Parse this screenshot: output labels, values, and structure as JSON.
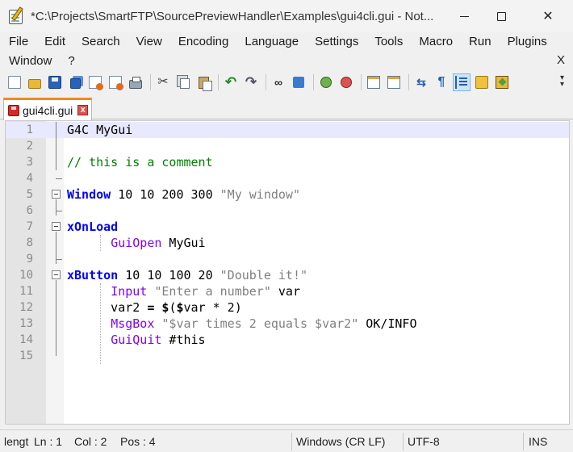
{
  "window": {
    "title": "*C:\\Projects\\SmartFTP\\SourcePreviewHandler\\Examples\\gui4cli.gui - Not..."
  },
  "menu": {
    "row1": [
      "File",
      "Edit",
      "Search",
      "View",
      "Encoding",
      "Language",
      "Settings",
      "Tools",
      "Macro",
      "Run",
      "Plugins"
    ],
    "row2": [
      "Window",
      "?"
    ],
    "close_doc": "X"
  },
  "toolbar": {
    "buttons": [
      "new-file-icon",
      "open-folder-icon",
      "save-icon",
      "save-all-icon",
      "close-icon",
      "close-all-icon",
      "print-icon",
      "cut-icon",
      "copy-icon",
      "paste-icon",
      "undo-icon",
      "redo-icon",
      "find-icon",
      "replace-icon",
      "zoom-in-icon",
      "zoom-out-icon",
      "sync-vertical-icon",
      "sync-horizontal-icon",
      "word-wrap-icon",
      "show-all-characters-icon",
      "indent-guide-icon",
      "user-language-icon",
      "bookmark-icon"
    ]
  },
  "tab": {
    "label": "gui4cli.gui",
    "close": "x"
  },
  "editor": {
    "lines": [
      {
        "n": "1",
        "tokens": [
          {
            "t": "G4C MyGui",
            "c": "plain"
          }
        ]
      },
      {
        "n": "2",
        "tokens": []
      },
      {
        "n": "3",
        "tokens": [
          {
            "t": "// this is a comment",
            "c": "cmt"
          }
        ]
      },
      {
        "n": "4",
        "tokens": []
      },
      {
        "n": "5",
        "tokens": [
          {
            "t": "Window",
            "c": "kw"
          },
          {
            "t": " 10 10 200 300 ",
            "c": "num"
          },
          {
            "t": "\"My window\"",
            "c": "str"
          }
        ]
      },
      {
        "n": "6",
        "tokens": []
      },
      {
        "n": "7",
        "tokens": [
          {
            "t": "xOnLoad",
            "c": "kw"
          }
        ]
      },
      {
        "n": "8",
        "tokens": [
          {
            "t": "      ",
            "c": "plain"
          },
          {
            "t": "GuiOpen",
            "c": "cmd"
          },
          {
            "t": " MyGui",
            "c": "plain"
          }
        ]
      },
      {
        "n": "9",
        "tokens": []
      },
      {
        "n": "10",
        "tokens": [
          {
            "t": "xButton",
            "c": "kw"
          },
          {
            "t": " 10 10 100 20 ",
            "c": "num"
          },
          {
            "t": "\"Double it!\"",
            "c": "str"
          }
        ]
      },
      {
        "n": "11",
        "tokens": [
          {
            "t": "      ",
            "c": "plain"
          },
          {
            "t": "Input",
            "c": "cmd"
          },
          {
            "t": " ",
            "c": "plain"
          },
          {
            "t": "\"Enter a number\"",
            "c": "str"
          },
          {
            "t": " var",
            "c": "plain"
          }
        ]
      },
      {
        "n": "12",
        "tokens": [
          {
            "t": "      var2 ",
            "c": "plain"
          },
          {
            "t": "=",
            "c": "op"
          },
          {
            "t": " ",
            "c": "plain"
          },
          {
            "t": "$",
            "c": "op"
          },
          {
            "t": "(",
            "c": "plain"
          },
          {
            "t": "$",
            "c": "op"
          },
          {
            "t": "var * 2)",
            "c": "plain"
          }
        ]
      },
      {
        "n": "13",
        "tokens": [
          {
            "t": "      ",
            "c": "plain"
          },
          {
            "t": "MsgBox",
            "c": "cmd"
          },
          {
            "t": " ",
            "c": "plain"
          },
          {
            "t": "\"$var times 2 equals $var2\"",
            "c": "str"
          },
          {
            "t": " OK/INFO",
            "c": "plain"
          }
        ]
      },
      {
        "n": "14",
        "tokens": [
          {
            "t": "      ",
            "c": "plain"
          },
          {
            "t": "GuiQuit",
            "c": "cmd"
          },
          {
            "t": " #this",
            "c": "plain"
          }
        ]
      },
      {
        "n": "15",
        "tokens": []
      }
    ]
  },
  "status": {
    "length": "lengt",
    "ln": "Ln : 1",
    "col": "Col : 2",
    "pos": "Pos : 4",
    "eol": "Windows (CR LF)",
    "encoding": "UTF-8",
    "mode": "INS"
  }
}
